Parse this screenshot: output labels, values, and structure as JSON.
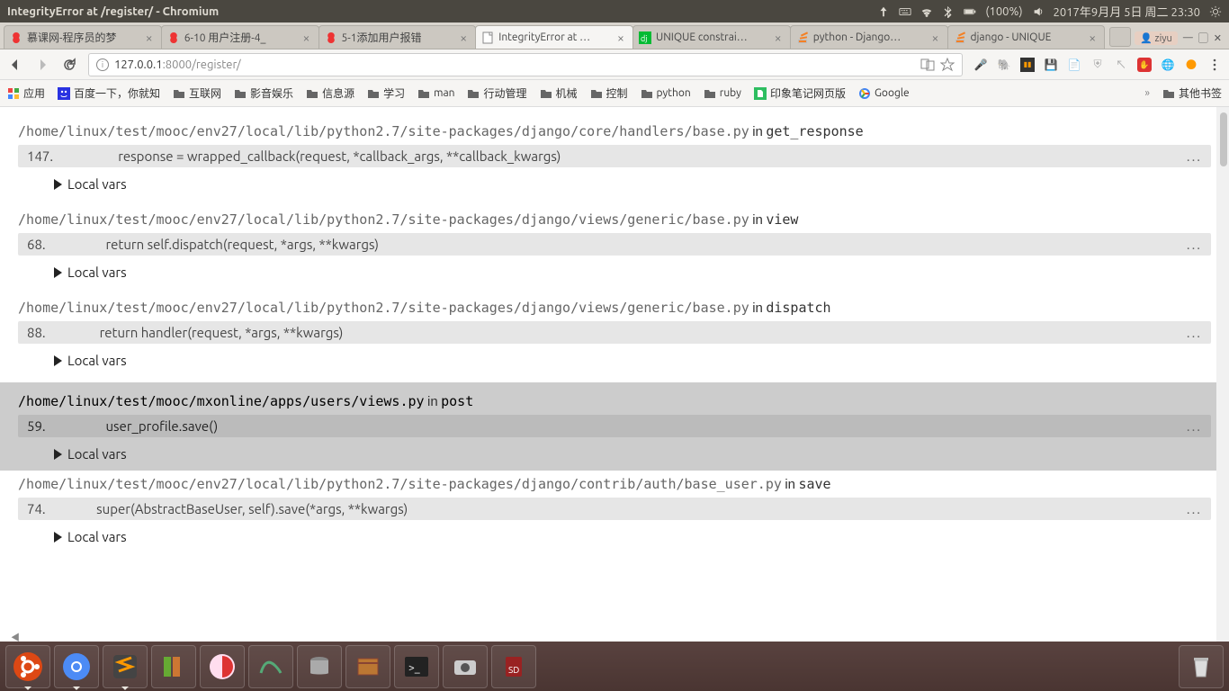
{
  "menubar": {
    "window_title": "IntegrityError at /register/ - Chromium",
    "battery": "(100%)",
    "datetime": "2017年9月月 5日 周二 23:30"
  },
  "tabs": [
    {
      "label": "慕课网-程序员的梦",
      "icon": "imooc",
      "active": false
    },
    {
      "label": "6-10 用户注册-4_",
      "icon": "imooc",
      "active": false
    },
    {
      "label": "5-1添加用户报错",
      "icon": "imooc",
      "active": false
    },
    {
      "label": "IntegrityError at …",
      "icon": "page",
      "active": true
    },
    {
      "label": "UNIQUE constrai…",
      "icon": "django",
      "active": false
    },
    {
      "label": "python - Django…",
      "icon": "so",
      "active": false
    },
    {
      "label": "django - UNIQUE",
      "icon": "so",
      "active": false
    }
  ],
  "wincorner": {
    "user": "ziyu"
  },
  "addr": {
    "host": "127.0.0.1",
    "port_path": ":8000/register/"
  },
  "bookmarks": [
    {
      "label": "应用",
      "icon": "apps"
    },
    {
      "label": "百度一下，你就知",
      "icon": "baidu"
    },
    {
      "label": "互联网",
      "icon": "folder"
    },
    {
      "label": "影音娱乐",
      "icon": "folder"
    },
    {
      "label": "信息源",
      "icon": "folder"
    },
    {
      "label": "学习",
      "icon": "folder"
    },
    {
      "label": "man",
      "icon": "folder"
    },
    {
      "label": "行动管理",
      "icon": "folder"
    },
    {
      "label": "机械",
      "icon": "folder"
    },
    {
      "label": "控制",
      "icon": "folder"
    },
    {
      "label": "python",
      "icon": "folder"
    },
    {
      "label": "ruby",
      "icon": "folder"
    },
    {
      "label": "印象笔记网页版",
      "icon": "evernote"
    },
    {
      "label": "Google",
      "icon": "google"
    }
  ],
  "other_bookmarks": "其他书签",
  "traceback": {
    "localvars_label": "Local vars",
    "frames": [
      {
        "path": "/home/linux/test/mooc/env27/local/lib/python2.7/site-packages/django/core/handlers/base.py",
        "func": "get_response",
        "lineno": "147.",
        "code": "            response = wrapped_callback(request, *callback_args, **callback_kwargs)",
        "hl": false
      },
      {
        "path": "/home/linux/test/mooc/env27/local/lib/python2.7/site-packages/django/views/generic/base.py",
        "func": "view",
        "lineno": "68.",
        "code": "        return self.dispatch(request, *args, **kwargs)",
        "hl": false
      },
      {
        "path": "/home/linux/test/mooc/env27/local/lib/python2.7/site-packages/django/views/generic/base.py",
        "func": "dispatch",
        "lineno": "88.",
        "code": "      return handler(request, *args, **kwargs)",
        "hl": false
      },
      {
        "path": "/home/linux/test/mooc/mxonline/apps/users/views.py",
        "func": "post",
        "lineno": "59.",
        "code": "        user_profile.save()",
        "hl": true
      },
      {
        "path": "/home/linux/test/mooc/env27/local/lib/python2.7/site-packages/django/contrib/auth/base_user.py",
        "func": "save",
        "lineno": "74.",
        "code": "     super(AbstractBaseUser, self).save(*args, **kwargs)",
        "hl": false
      }
    ]
  },
  "launcher_apps": [
    "ubuntu",
    "chromium",
    "sublime",
    "books",
    "planner",
    "mysql",
    "dbtool",
    "files",
    "terminal",
    "camera",
    "sd"
  ]
}
